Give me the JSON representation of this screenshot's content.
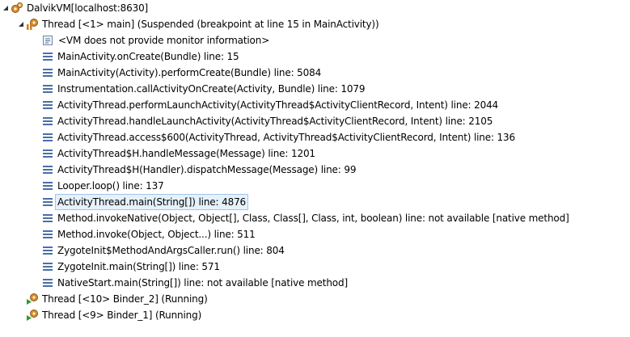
{
  "debug_view": {
    "vm": {
      "label": "DalvikVM[localhost:8630]"
    },
    "main_thread": {
      "label": "Thread [<1> main] (Suspended (breakpoint at line 15 in MainActivity))"
    },
    "monitor_info": "<VM does not provide monitor information>",
    "frames": [
      "MainActivity.onCreate(Bundle) line: 15",
      "MainActivity(Activity).performCreate(Bundle) line: 5084",
      "Instrumentation.callActivityOnCreate(Activity, Bundle) line: 1079",
      "ActivityThread.performLaunchActivity(ActivityThread$ActivityClientRecord, Intent) line: 2044",
      "ActivityThread.handleLaunchActivity(ActivityThread$ActivityClientRecord, Intent) line: 2105",
      "ActivityThread.access$600(ActivityThread, ActivityThread$ActivityClientRecord, Intent) line: 136",
      "ActivityThread$H.handleMessage(Message) line: 1201",
      "ActivityThread$H(Handler).dispatchMessage(Message) line: 99",
      "Looper.loop() line: 137",
      "ActivityThread.main(String[]) line: 4876",
      "Method.invokeNative(Object, Object[], Class, Class[], Class, int, boolean) line: not available [native method]",
      "Method.invoke(Object, Object...) line: 511",
      "ZygoteInit$MethodAndArgsCaller.run() line: 804",
      "ZygoteInit.main(String[]) line: 571",
      "NativeStart.main(String[]) line: not available [native method]"
    ],
    "selected_frame_index": 9,
    "other_threads": [
      "Thread [<10> Binder_2] (Running)",
      "Thread [<9> Binder_1] (Running)"
    ],
    "icons": {
      "vm": "dalvik-vm-icon",
      "suspended_thread": "suspended-thread-icon",
      "running_thread": "running-thread-icon",
      "monitor_info": "monitor-info-icon",
      "stack_frame": "stack-frame-icon"
    },
    "colors": {
      "selection_background": "#e5f1fb",
      "selection_border": "#9ec6ea",
      "frame_icon_blue": "#4a6fa5",
      "thread_gear_orange": "#c8811c",
      "running_green": "#2f9b2f"
    }
  }
}
